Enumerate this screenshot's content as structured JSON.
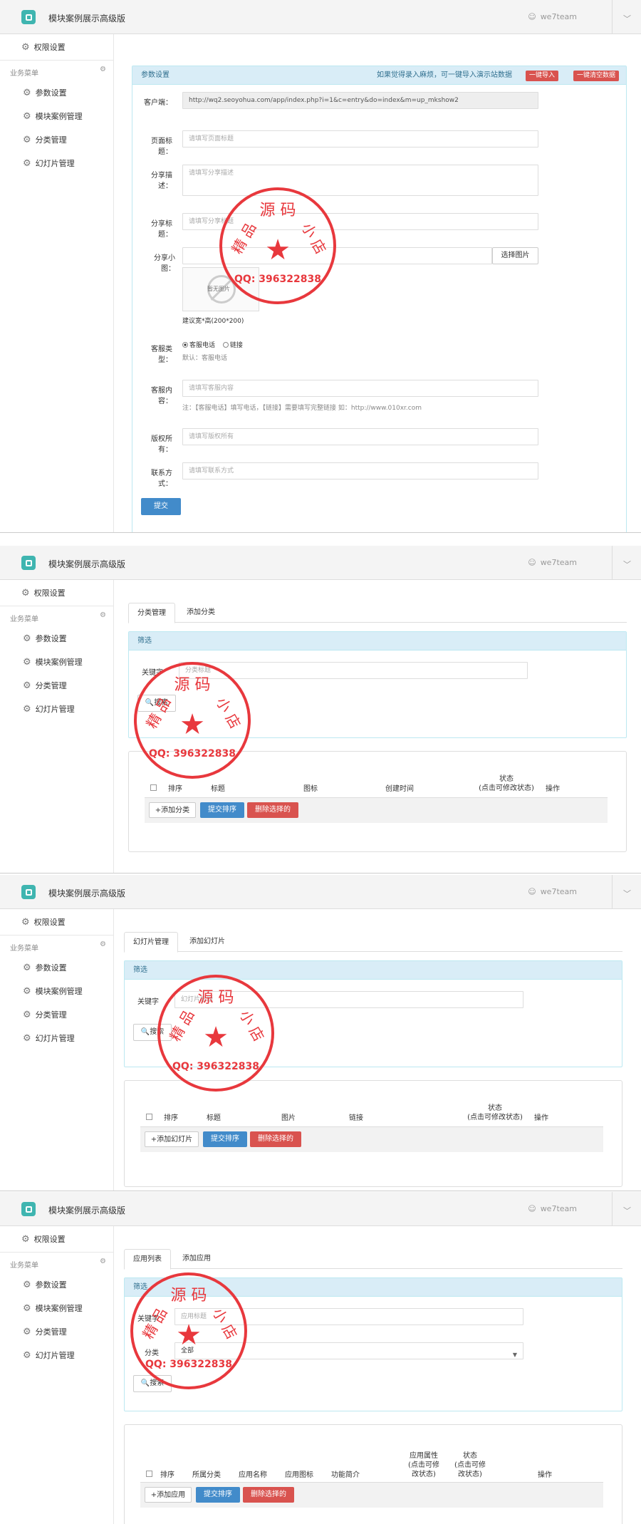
{
  "app": {
    "title": "模块案例展示高级版",
    "user": "we7team"
  },
  "sidebar": {
    "permission": "权限设置",
    "menu_heading": "业务菜单",
    "items": [
      "参数设置",
      "模块案例管理",
      "分类管理",
      "幻灯片管理"
    ]
  },
  "stamp": {
    "top": "源 码",
    "left": "精 品",
    "right": "小 店",
    "qq": "QQ: 396322838"
  },
  "settings": {
    "panel_title": "参数设置",
    "hint": "如果觉得录入麻烦，可一键导入演示站数据",
    "btn_import": "一键导入",
    "btn_clear": "一键清空数据",
    "client_label": "客户端：",
    "client_value": "http://wq2.seoyohua.com/app/index.php?i=1&c=entry&do=index&m=up_mkshow2",
    "title_label": "页面标题：",
    "title_ph": "请填写页面标题",
    "desc_label": "分享描述：",
    "desc_ph": "请填写分享描述",
    "share_title_label": "分享标题：",
    "share_title_ph": "请填写分享标题",
    "thumb_label": "分享小图：",
    "choose_image": "选择图片",
    "no_image": "暂无图片",
    "size_hint": "建议宽*高(200*200)",
    "type_label": "客服类型：",
    "type_phone": "客服电话",
    "type_link": "链接",
    "type_default": "默认：客服电话",
    "content_label": "客服内容：",
    "content_ph": "请填写客服内容",
    "content_note": "注：【客服电话】填写电话，【链接】需要填写完整链接 如：http://www.010xr.com",
    "copyright_label": "版权所有：",
    "copyright_ph": "请填写版权所有",
    "contact_label": "联系方式：",
    "contact_ph": "请填写联系方式",
    "submit": "提交"
  },
  "category": {
    "tab_active": "分类管理",
    "tab_add": "添加分类",
    "filter_title": "筛选",
    "keyword_label": "关键字",
    "keyword_ph": "分类标题",
    "search": "搜索",
    "columns": [
      "排序",
      "标题",
      "图标",
      "创建时间",
      "状态\n(点击可修改状态)",
      "操作"
    ],
    "btn_add": "+添加分类",
    "btn_sort": "提交排序",
    "btn_delete": "删除选择的"
  },
  "slides": {
    "tab_active": "幻灯片管理",
    "tab_add": "添加幻灯片",
    "filter_title": "筛选",
    "keyword_label": "关键字",
    "keyword_ph": "幻灯片标题",
    "search": "搜索",
    "columns": [
      "排序",
      "标题",
      "图片",
      "链接",
      "状态\n(点击可修改状态)",
      "操作"
    ],
    "btn_add": "+添加幻灯片",
    "btn_sort": "提交排序",
    "btn_delete": "删除选择的"
  },
  "apps": {
    "tab_active": "应用列表",
    "tab_add": "添加应用",
    "filter_title": "筛选",
    "keyword_label": "关键字",
    "keyword_ph": "应用标题",
    "category_label": "分类",
    "category_value": "全部",
    "search": "搜索",
    "columns": [
      "排序",
      "所属分类",
      "应用名称",
      "应用图标",
      "功能简介",
      "应用属性\n(点击可修\n改状态)",
      "状态\n(点击可修\n改状态)",
      "操作"
    ],
    "btn_add": "+添加应用",
    "btn_sort": "提交排序",
    "btn_delete": "删除选择的"
  },
  "colors": {
    "accent": "#428bca",
    "danger": "#d9534f",
    "panel_head": "#d9edf7",
    "stamp": "#e8383d"
  }
}
